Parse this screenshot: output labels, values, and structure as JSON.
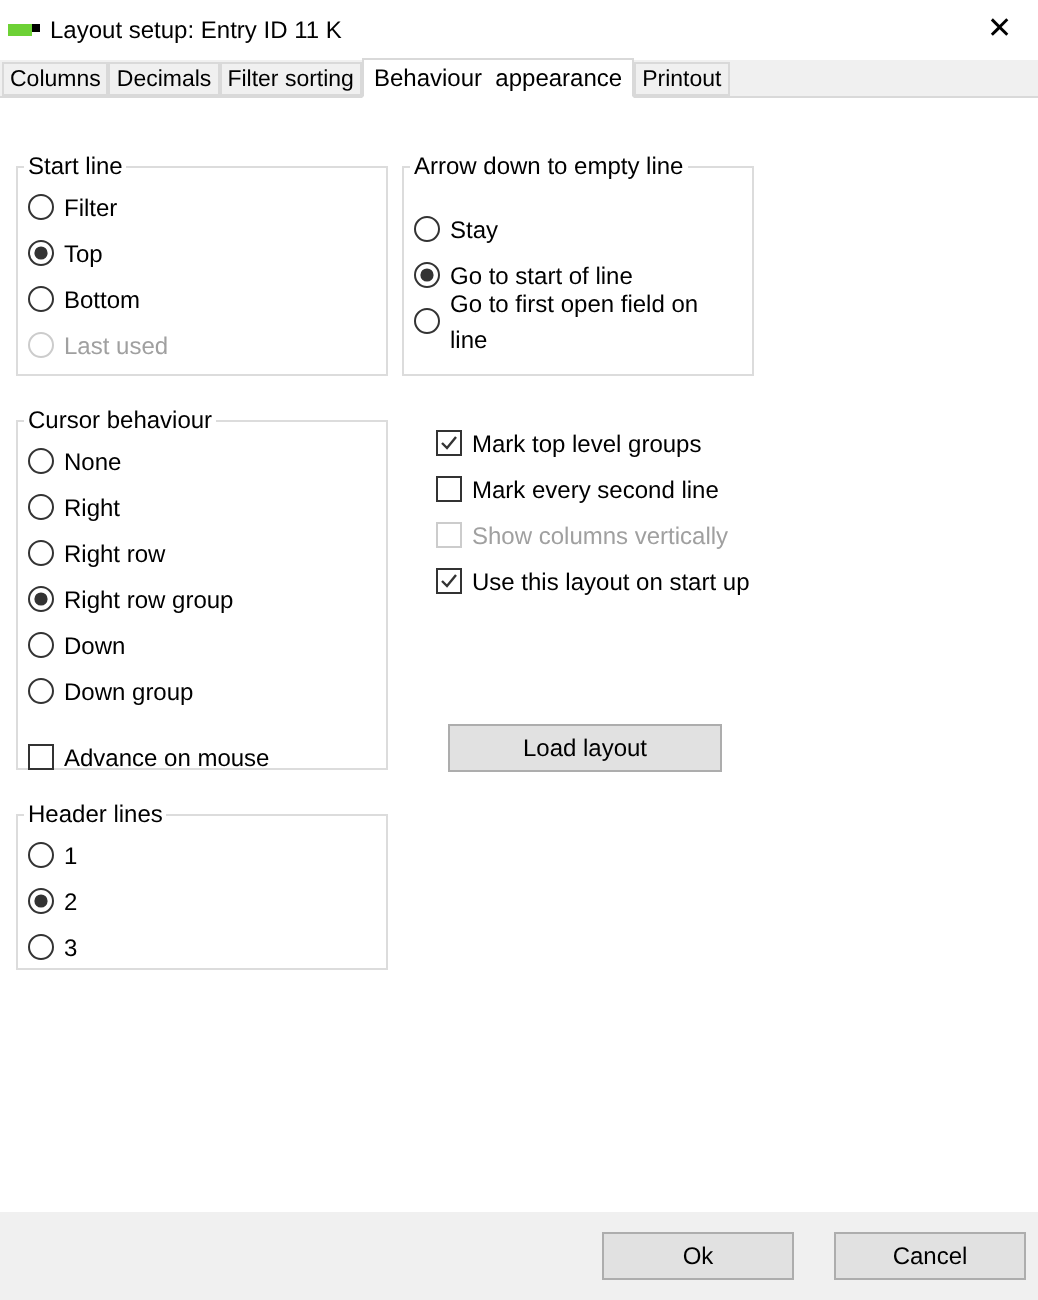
{
  "window": {
    "title": "Layout setup: Entry ID 11 K",
    "close": "✕"
  },
  "tabs": [
    {
      "label": "Columns",
      "selected": false
    },
    {
      "label": "Decimals",
      "selected": false
    },
    {
      "label": "Filter sorting",
      "selected": false
    },
    {
      "label": "Behaviour  appearance",
      "selected": true
    },
    {
      "label": "Printout",
      "selected": false
    }
  ],
  "start_line": {
    "title": "Start line",
    "options": [
      {
        "label": "Filter",
        "selected": false,
        "disabled": false
      },
      {
        "label": "Top",
        "selected": true,
        "disabled": false
      },
      {
        "label": "Bottom",
        "selected": false,
        "disabled": false
      },
      {
        "label": "Last used",
        "selected": false,
        "disabled": true
      }
    ]
  },
  "arrow_down": {
    "title": "Arrow down to empty line",
    "options": [
      {
        "label": "Stay",
        "selected": false,
        "disabled": false
      },
      {
        "label": "Go to start of line",
        "selected": true,
        "disabled": false
      },
      {
        "label": "Go to first open field on line",
        "selected": false,
        "disabled": false
      }
    ]
  },
  "cursor_behaviour": {
    "title": "Cursor behaviour",
    "options": [
      {
        "label": "None",
        "selected": false,
        "disabled": false
      },
      {
        "label": "Right",
        "selected": false,
        "disabled": false
      },
      {
        "label": "Right row",
        "selected": false,
        "disabled": false
      },
      {
        "label": "Right row group",
        "selected": true,
        "disabled": false
      },
      {
        "label": "Down",
        "selected": false,
        "disabled": false
      },
      {
        "label": "Down group",
        "selected": false,
        "disabled": false
      }
    ],
    "advance_on_mouse": {
      "label": "Advance on mouse",
      "checked": false,
      "disabled": false
    }
  },
  "header_lines": {
    "title": "Header lines",
    "options": [
      {
        "label": "1",
        "selected": false,
        "disabled": false
      },
      {
        "label": "2",
        "selected": true,
        "disabled": false
      },
      {
        "label": "3",
        "selected": false,
        "disabled": false
      }
    ]
  },
  "checkboxes": [
    {
      "label": "Mark top level groups",
      "checked": true,
      "disabled": false
    },
    {
      "label": "Mark every second line",
      "checked": false,
      "disabled": false
    },
    {
      "label": "Show columns vertically",
      "checked": false,
      "disabled": true
    },
    {
      "label": "Use this layout on start up",
      "checked": true,
      "disabled": false
    }
  ],
  "load_button": "Load layout",
  "buttons": [
    "Ok",
    "Cancel"
  ]
}
